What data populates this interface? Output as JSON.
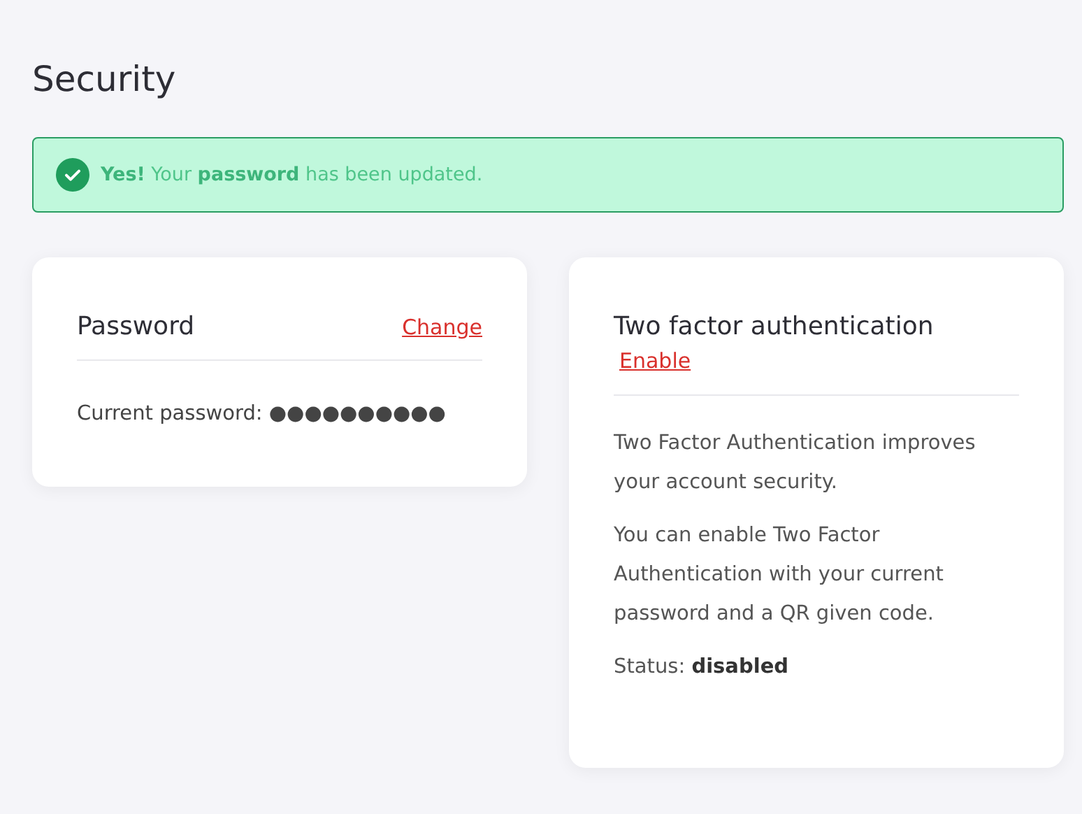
{
  "page": {
    "title": "Security"
  },
  "alert": {
    "kind": "success",
    "message": "**Yes!** Your **password** has been updated."
  },
  "password_card": {
    "title": "Password",
    "action": "Change",
    "current": "Current password: ●●●●●●●●●●"
  },
  "two_factor_card": {
    "title": "Two factor authentication",
    "action": "Enable",
    "paragraphs": [
      "Two Factor Authentication improves your account security.",
      "You can enable Two Factor Authentication with your current password and a QR given code.",
      "Status: **disabled**"
    ]
  }
}
